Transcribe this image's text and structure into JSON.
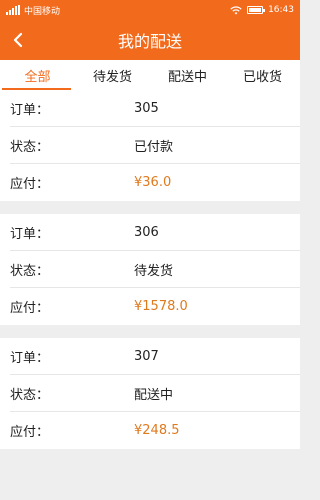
{
  "status_bar": {
    "carrier": "中国移动",
    "time": "16:43"
  },
  "header": {
    "title": "我的配送",
    "back_icon": "chevron-left-icon"
  },
  "tabs": [
    {
      "label": "全部",
      "active": true
    },
    {
      "label": "待发货",
      "active": false
    },
    {
      "label": "配送中",
      "active": false
    },
    {
      "label": "已收货",
      "active": false
    }
  ],
  "field_labels": {
    "order": "订单：",
    "status": "状态：",
    "payable": "应付："
  },
  "orders": [
    {
      "id": "305",
      "status": "已付款",
      "amount": "¥36.0"
    },
    {
      "id": "306",
      "status": "待发货",
      "amount": "¥1578.0"
    },
    {
      "id": "307",
      "status": "配送中",
      "amount": "¥248.5"
    }
  ],
  "colors": {
    "brand": "#f26b1d",
    "price": "#e07a1f"
  }
}
